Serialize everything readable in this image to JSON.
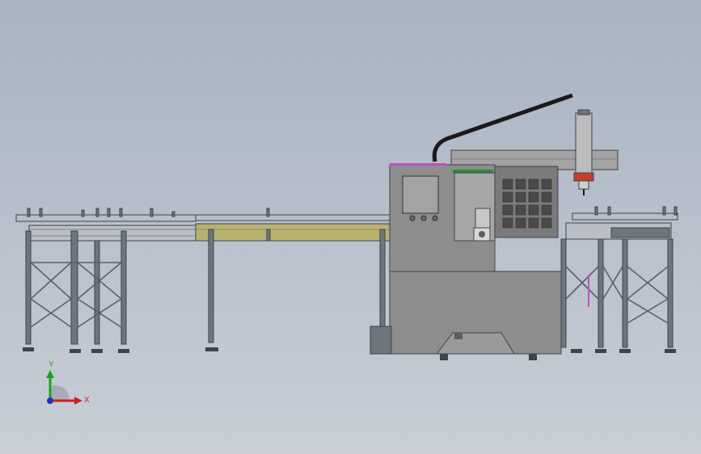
{
  "viewport": {
    "background_top": "#a8b2c0",
    "background_bottom": "#c9ced6"
  },
  "colors": {
    "frame": "#6f757d",
    "frame_dark": "#3e434a",
    "rail_fill": "#b9bec7",
    "olive_fill": "#b7b270",
    "cabinet": "#8d8d8d",
    "cabinet_dark": "#5e5e5e",
    "screen": "#a3a3a3",
    "cable_chain": "#1a1a1a",
    "accent_magenta": "#c050c0",
    "accent_green": "#2a8a3a"
  },
  "triad": {
    "x_label": "X",
    "y_label": "Y",
    "x_color": "#d02020",
    "y_color": "#20a020",
    "z_color": "#2030c0"
  },
  "parts": {
    "left_conveyor": "left-conveyor",
    "middle_conveyor": "middle-conveyor",
    "machine_cabinet": "machine-cabinet",
    "gantry": "gantry-arm",
    "right_conveyor": "right-conveyor"
  }
}
